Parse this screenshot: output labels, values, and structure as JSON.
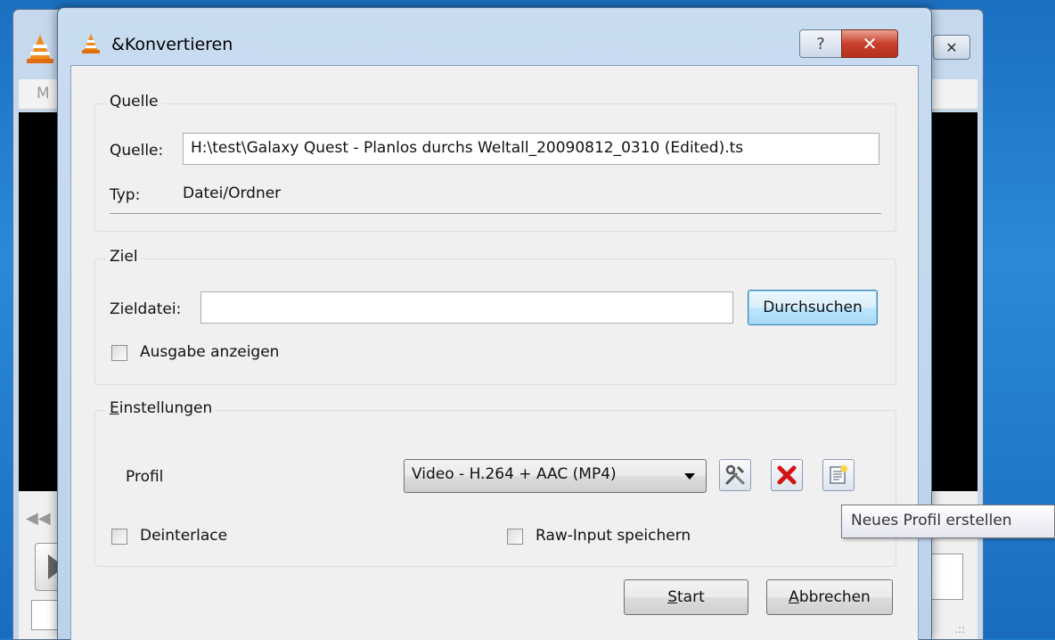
{
  "dialog": {
    "title": "&Konvertieren",
    "help_label": "?",
    "close_label": "✕"
  },
  "background_window": {
    "menu_text": "M",
    "close_label": "✕"
  },
  "source": {
    "legend": "Quelle",
    "source_label": "Quelle:",
    "source_value": "H:\\test\\Galaxy Quest - Planlos durchs Weltall_20090812_0310 (Edited).ts",
    "type_label": "Typ:",
    "type_value": "Datei/Ordner"
  },
  "target": {
    "legend": "Ziel",
    "file_label": "Zieldatei:",
    "file_value": "",
    "browse_label": "Durchsuchen",
    "show_output_label": "Ausgabe anzeigen",
    "show_output_checked": false
  },
  "settings": {
    "legend_accel": "E",
    "legend_rest": "instellungen",
    "profile_label": "Profil",
    "profile_selected": "Video - H.264 + AAC (MP4)",
    "deinterlace_label": "Deinterlace",
    "deinterlace_checked": false,
    "raw_input_label": "Raw-Input speichern",
    "raw_input_checked": false
  },
  "buttons": {
    "start_accel": "S",
    "start_rest": "tart",
    "cancel_accel": "A",
    "cancel_rest": "bbrechen"
  },
  "tooltip": {
    "text": "Neues Profil erstellen"
  },
  "icons": {
    "app": "vlc-cone-icon",
    "edit_profile": "tools-icon",
    "delete_profile": "red-x-icon",
    "new_profile": "new-profile-icon"
  },
  "colors": {
    "close_red": "#c8402c",
    "vlc_orange": "#f08c1c",
    "focus_blue": "#3c7fb1"
  }
}
